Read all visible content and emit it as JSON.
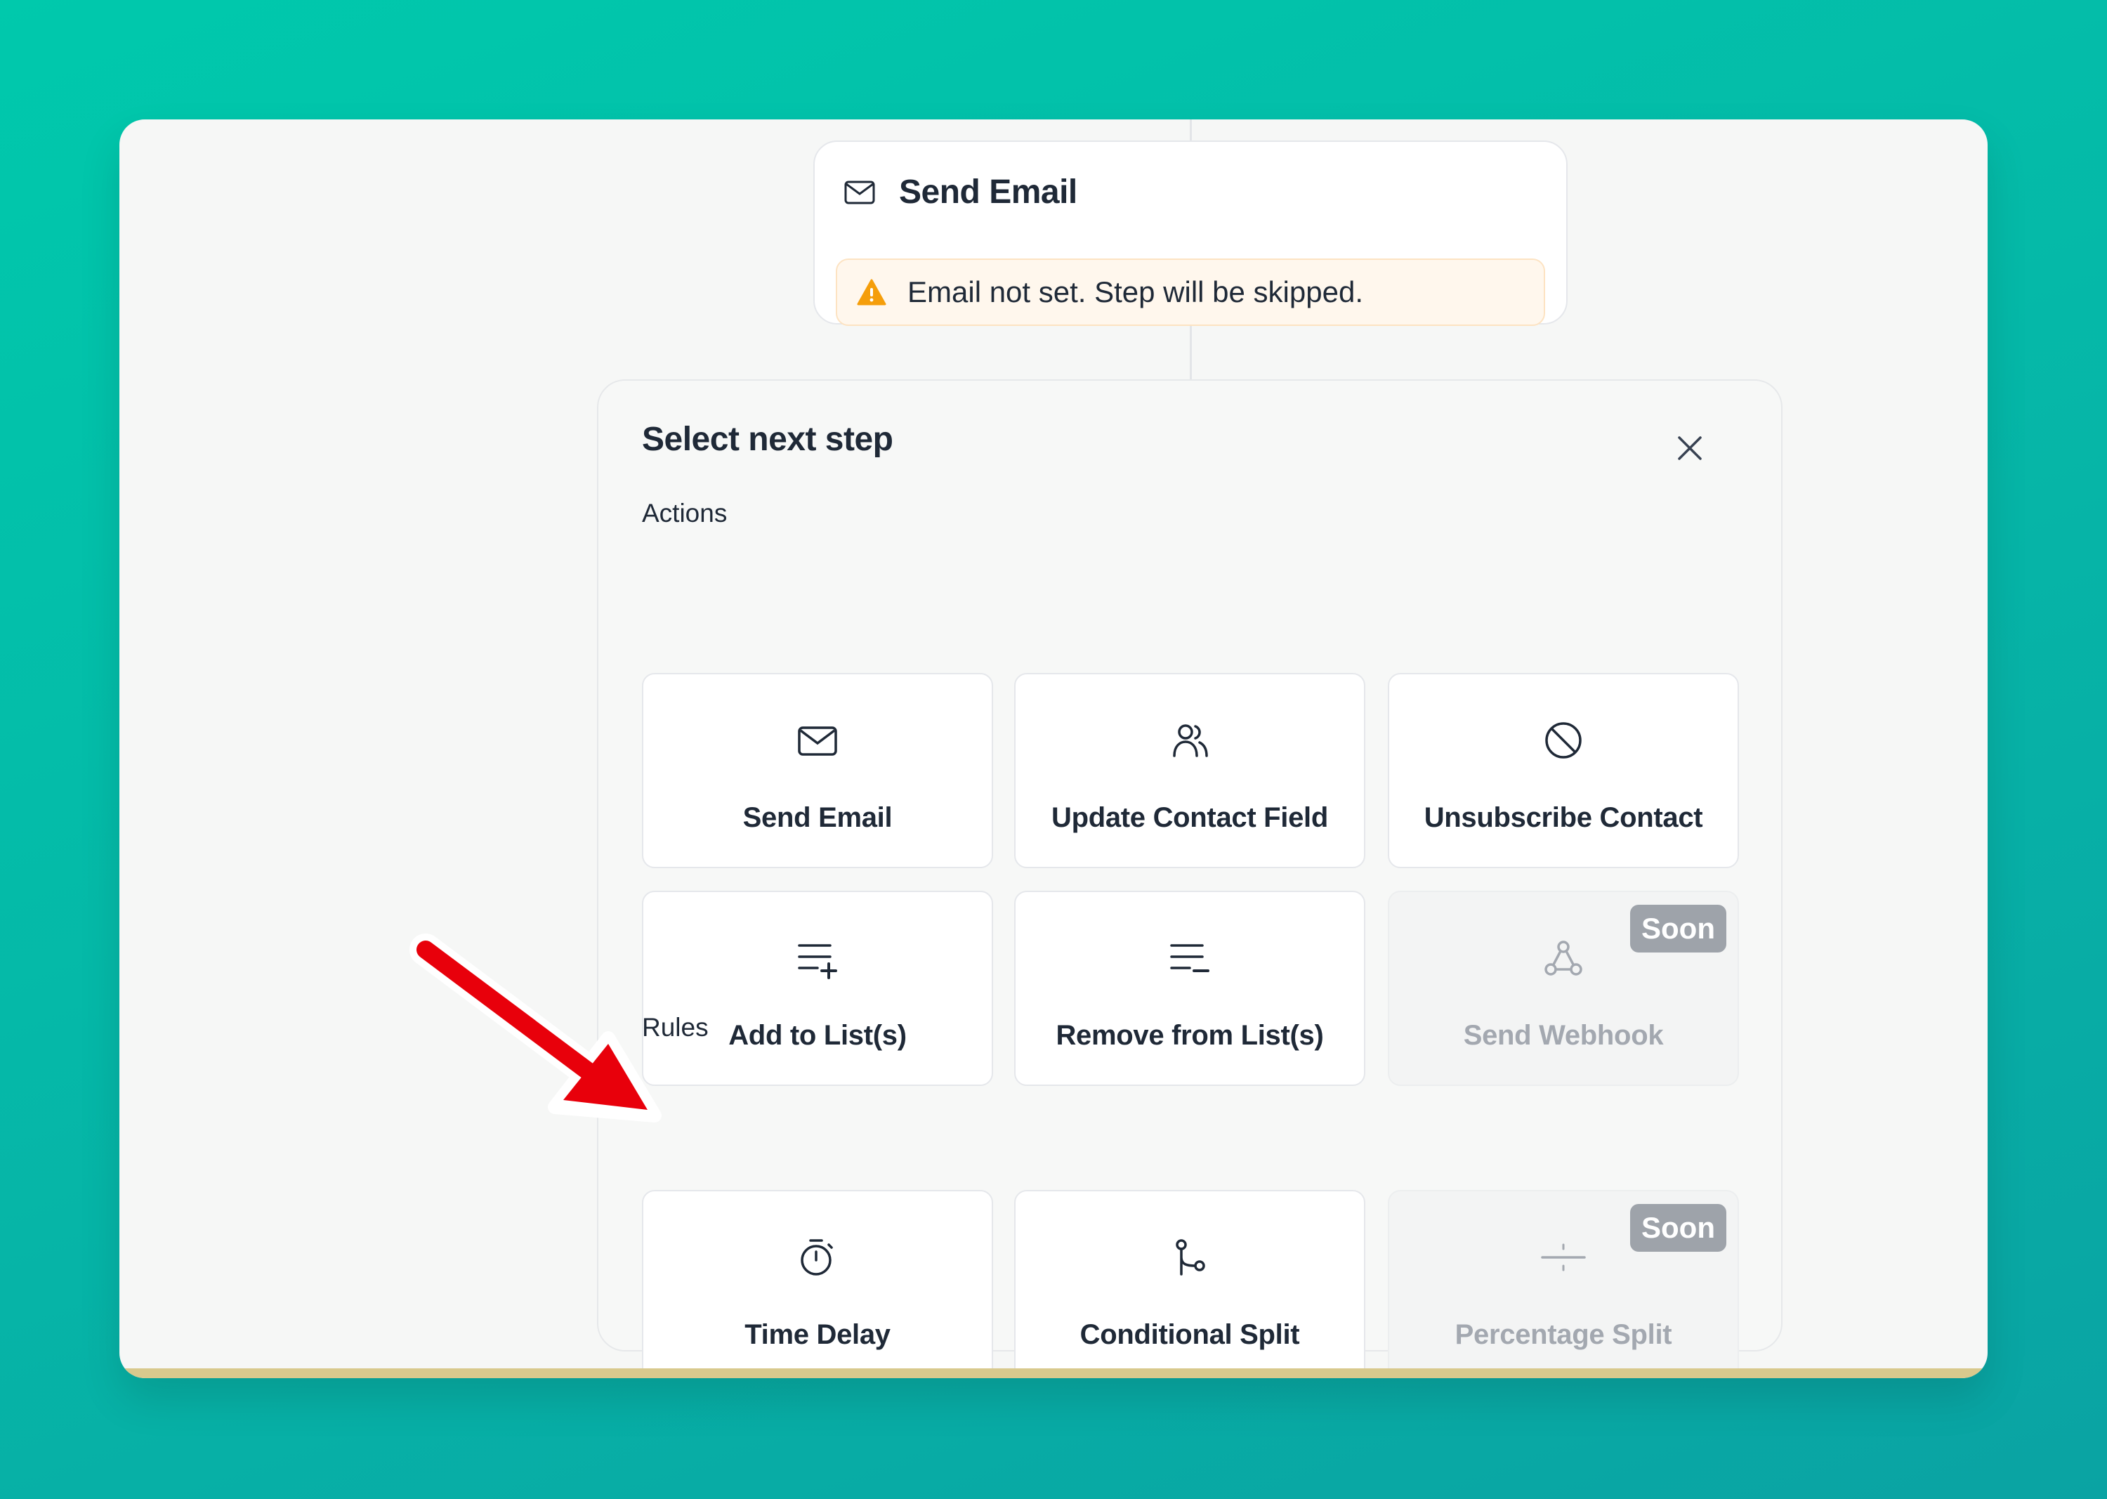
{
  "email_node": {
    "title": "Send Email",
    "warning": "Email not set. Step will be skipped.",
    "icon": "mail-icon",
    "warning_icon": "warning-triangle-icon"
  },
  "panel": {
    "title": "Select next step",
    "close_icon": "close-icon",
    "actions_label": "Actions",
    "rules_label": "Rules",
    "actions": [
      {
        "label": "Send Email",
        "icon": "mail-icon"
      },
      {
        "label": "Update Contact Field",
        "icon": "users-icon"
      },
      {
        "label": "Unsubscribe Contact",
        "icon": "ban-icon"
      },
      {
        "label": "Add to List(s)",
        "icon": "list-plus-icon"
      },
      {
        "label": "Remove from List(s)",
        "icon": "list-minus-icon"
      },
      {
        "label": "Send Webhook",
        "icon": "webhook-icon",
        "badge": "Soon"
      }
    ],
    "rules": [
      {
        "label": "Time Delay",
        "icon": "timer-icon"
      },
      {
        "label": "Conditional Split",
        "icon": "split-icon"
      },
      {
        "label": "Percentage Split",
        "icon": "divide-icon",
        "badge": "Soon"
      }
    ]
  },
  "colors": {
    "background": "#00c2ab",
    "annotation_arrow": "#e8000b",
    "warning": "#f59e0b",
    "text": "#1f2937",
    "disabled_text": "#a3a8b0"
  }
}
